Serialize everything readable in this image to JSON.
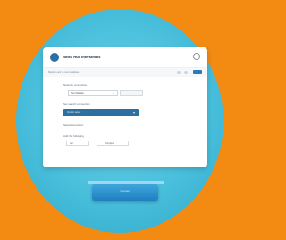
{
  "app": {
    "title": "Notes Hub Interstitials"
  },
  "infobar": {
    "text": "Maintain and re-scan database"
  },
  "sections": {
    "connection_label": "Network connection",
    "select_value": "Set Maintain",
    "filter_label": "Set search connection",
    "source_value": "Vendor select",
    "extra_label": "Select Accordion",
    "entry_label": "Add the following",
    "entry_value": "Val",
    "entry_secondary": "Compute"
  },
  "device": {
    "label": "Connect"
  },
  "colors": {
    "background": "#f38a12",
    "circle": "#49bfdc",
    "accent": "#2c6fa0"
  }
}
